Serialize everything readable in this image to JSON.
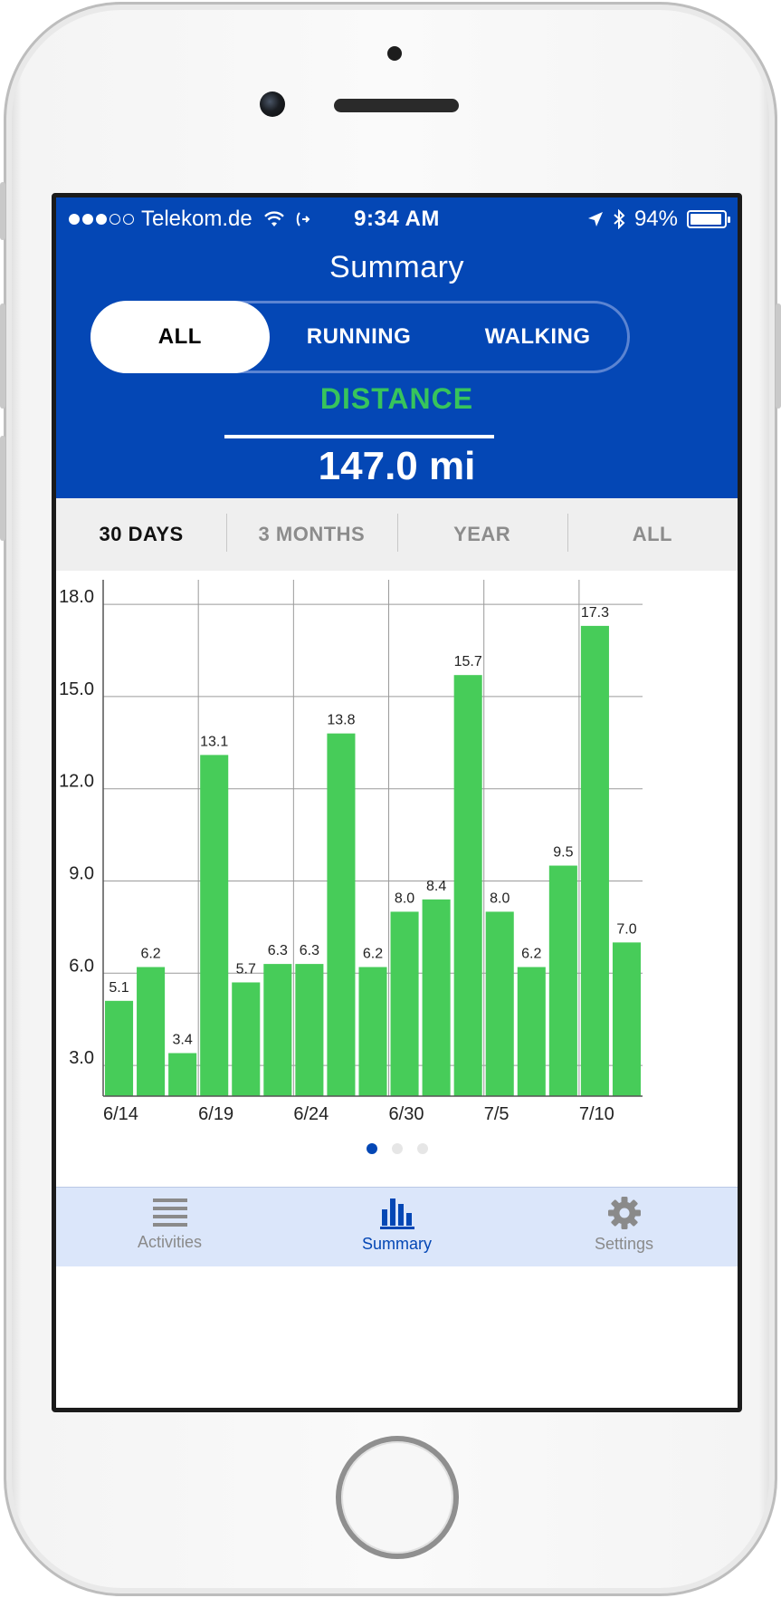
{
  "status_bar": {
    "carrier": "Telekom.de",
    "time": "9:34 AM",
    "battery": "94%",
    "battery_level": 0.94
  },
  "header": {
    "title": "Summary"
  },
  "activity_filter": {
    "options": [
      "ALL",
      "RUNNING",
      "WALKING"
    ],
    "selected": "ALL"
  },
  "metric": {
    "label": "DISTANCE",
    "value": "147.0 mi"
  },
  "time_ranges": {
    "options": [
      "30 DAYS",
      "3 MONTHS",
      "YEAR",
      "ALL"
    ],
    "selected": "30 DAYS"
  },
  "chart_data": {
    "type": "bar",
    "values": [
      5.1,
      6.2,
      3.4,
      13.1,
      5.7,
      6.3,
      6.3,
      13.8,
      6.2,
      8.0,
      8.4,
      15.7,
      8.0,
      6.2,
      9.5,
      17.3,
      7.0
    ],
    "value_labels": [
      "5.1",
      "6.2",
      "3.4",
      "13.1",
      "5.7",
      "6.3",
      "6.3",
      "13.8",
      "6.2",
      "8.0",
      "8.4",
      "15.7",
      "8.0",
      "6.2",
      "9.5",
      "17.3",
      "7.0"
    ],
    "x_tick_labels": [
      "6/14",
      "6/19",
      "6/24",
      "6/30",
      "7/5",
      "7/10"
    ],
    "y_ticks": [
      3.0,
      6.0,
      9.0,
      12.0,
      15.0,
      18.0
    ],
    "y_tick_labels": [
      "3.0",
      "6.0",
      "9.0",
      "12.0",
      "15.0",
      "18.0"
    ],
    "ylim": [
      2.0,
      18.8
    ],
    "bar_color": "#47cc59",
    "grid": true,
    "title": "",
    "xlabel": "",
    "ylabel": ""
  },
  "pager": {
    "count": 3,
    "active": 0
  },
  "tab_bar": {
    "items": [
      {
        "label": "Activities",
        "icon": "list-icon"
      },
      {
        "label": "Summary",
        "icon": "bar-chart-icon"
      },
      {
        "label": "Settings",
        "icon": "gear-icon"
      }
    ],
    "active": "Summary"
  },
  "colors": {
    "brand_blue": "#0447b5",
    "accent_green": "#37c45c",
    "tab_bar_bg": "#dbe6fa"
  }
}
